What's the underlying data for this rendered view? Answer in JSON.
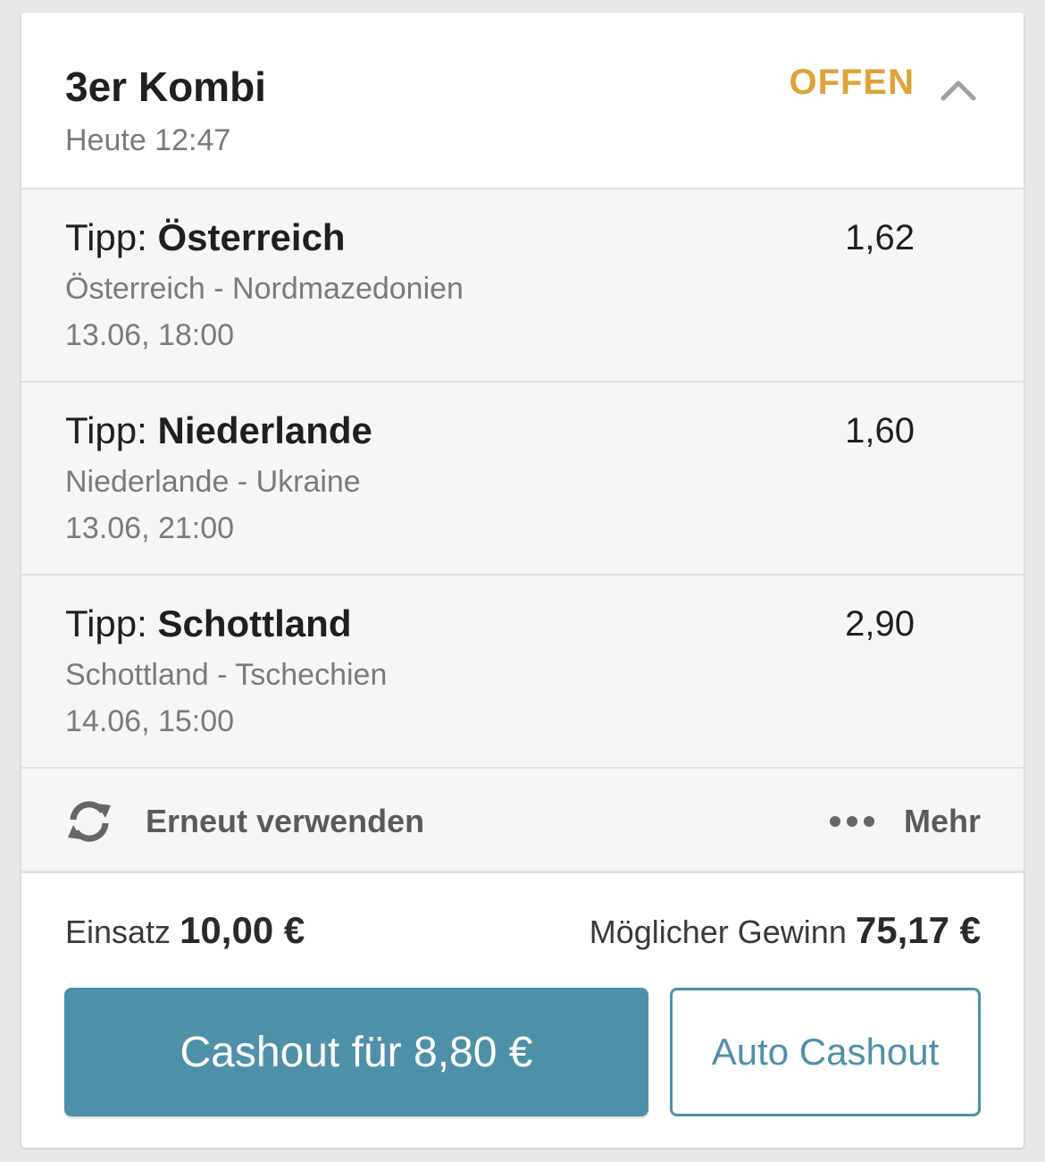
{
  "header": {
    "title": "3er Kombi",
    "time": "Heute 12:47",
    "status": "OFFEN",
    "status_color": "#e0a238",
    "toggle_icon": "chevron-up-icon"
  },
  "selections": [
    {
      "tip_prefix": "Tipp: ",
      "tip_team": "Österreich",
      "odds": "1,62",
      "match": "Österreich - Nordmazedonien",
      "date": "13.06, 18:00"
    },
    {
      "tip_prefix": "Tipp: ",
      "tip_team": "Niederlande",
      "odds": "1,60",
      "match": "Niederlande - Ukraine",
      "date": "13.06, 21:00"
    },
    {
      "tip_prefix": "Tipp: ",
      "tip_team": "Schottland",
      "odds": "2,90",
      "match": "Schottland - Tschechien",
      "date": "14.06, 15:00"
    }
  ],
  "actions": {
    "reuse_label": "Erneut verwenden",
    "reuse_icon": "refresh-icon",
    "more_label": "Mehr",
    "more_icon": "more-dots-icon"
  },
  "summary": {
    "stake_label": "Einsatz",
    "stake_value": "10,00 €",
    "win_label": "Möglicher Gewinn",
    "win_value": "75,17 €"
  },
  "buttons": {
    "cashout_label": "Cashout für 8,80 €",
    "auto_cashout_label": "Auto Cashout",
    "accent_color": "#4f90a9"
  }
}
